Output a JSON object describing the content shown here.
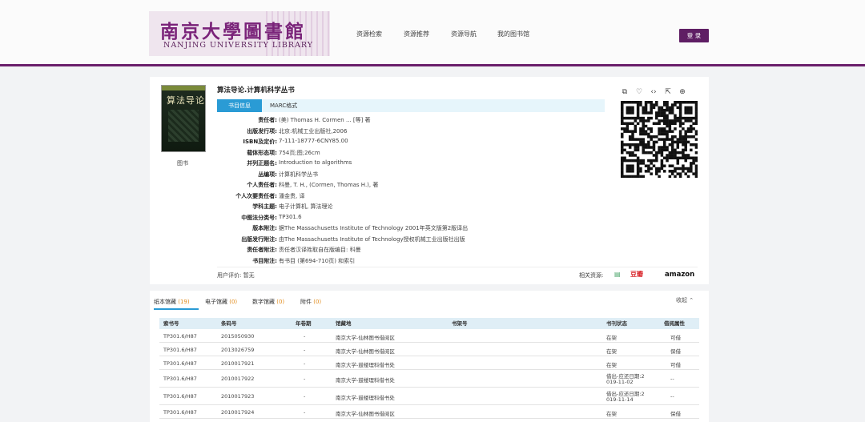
{
  "header": {
    "logo_cn": "南京大學圖書館",
    "logo_en": "NANJING UNIVERSITY LIBRARY",
    "nav": [
      "资源检索",
      "资源推荐",
      "资源导航",
      "我的图书馆"
    ],
    "login": "登 录",
    "accent_color": "#6a1f6b"
  },
  "book": {
    "cover_title": "算法导论",
    "type_label": "图书",
    "title": "算法导论.计算机科学丛书",
    "tabs": [
      "书目信息",
      "MARC格式"
    ],
    "fields": [
      {
        "label": "责任者:",
        "value": "(美) Thomas H. Cormen ... [等] 著"
      },
      {
        "label": "出版发行项:",
        "value": "北京:机械工业出版社,2006"
      },
      {
        "label": "ISBN及定价:",
        "value": "7-111-18777-6CNY85.00"
      },
      {
        "label": "载体形态项:",
        "value": "754页;图;26cm"
      },
      {
        "label": "并列正题名:",
        "value": "Introduction to algorithms"
      },
      {
        "label": "丛编项:",
        "value": "计算机科学丛书"
      },
      {
        "label": "个人责任者:",
        "value": "科曼, T. H., (Cormen, Thomas H.), 著"
      },
      {
        "label": "个人次要责任者:",
        "value": "潘金贵, 译"
      },
      {
        "label": "学科主题:",
        "value": "电子计算机, 算法理论"
      },
      {
        "label": "中图法分类号:",
        "value": "TP301.6"
      },
      {
        "label": "版本附注:",
        "value": "据The Massachusetts Institute of Technology 2001年英文版第2版译出"
      },
      {
        "label": "出版发行附注:",
        "value": "由The Massachusetts Institute of Technology授权机械工业出版社出版"
      },
      {
        "label": "责任者附注:",
        "value": "责任者汉译姓取自在版编目: 科曼"
      },
      {
        "label": "书目附注:",
        "value": "有书目 (第694-710页) 和索引"
      }
    ],
    "rating_label": "用户评价:",
    "rating_value": "暂无",
    "related_label": "相关资源:",
    "related_sources": [
      "豆瓣",
      "amazon"
    ]
  },
  "tools": [
    "export-icon",
    "heart-icon",
    "code-icon",
    "share-icon",
    "cart-icon"
  ],
  "holdings": {
    "tabs": [
      {
        "label": "纸本馆藏",
        "count": "(19)"
      },
      {
        "label": "电子馆藏",
        "count": "(0)"
      },
      {
        "label": "数字馆藏",
        "count": "(0)"
      },
      {
        "label": "附件",
        "count": "(0)"
      }
    ],
    "collapse": "收起",
    "columns": [
      "索书号",
      "条码号",
      "年卷期",
      "馆藏地",
      "书架号",
      "书刊状态",
      "借阅属性"
    ],
    "rows": [
      {
        "call": "TP301.6/H87",
        "barcode": "2015050930",
        "vol": "-",
        "loc": "南京大学-仙林图书借阅区",
        "status": "在架",
        "status2": "",
        "attr": "可借"
      },
      {
        "call": "TP301.6/H87",
        "barcode": "2013026759",
        "vol": "-",
        "loc": "南京大学-仙林图书借阅区",
        "status": "在架",
        "status2": "",
        "attr": "保借"
      },
      {
        "call": "TP301.6/H87",
        "barcode": "2010017921",
        "vol": "-",
        "loc": "南京大学-鼓楼理科借书处",
        "status": "在架",
        "status2": "",
        "attr": "可借"
      },
      {
        "call": "TP301.6/H87",
        "barcode": "2010017922",
        "vol": "-",
        "loc": "南京大学-鼓楼理科借书处",
        "status": "借出-应还日期:2",
        "status2": "019-11-02",
        "attr": "--"
      },
      {
        "call": "TP301.6/H87",
        "barcode": "2010017923",
        "vol": "-",
        "loc": "南京大学-鼓楼理科借书处",
        "status": "借出-应还日期:2",
        "status2": "019-11-14",
        "attr": "--"
      },
      {
        "call": "TP301.6/H87",
        "barcode": "2010017924",
        "vol": "-",
        "loc": "南京大学-仙林图书借阅区",
        "status": "在架",
        "status2": "",
        "attr": "保借"
      }
    ]
  }
}
